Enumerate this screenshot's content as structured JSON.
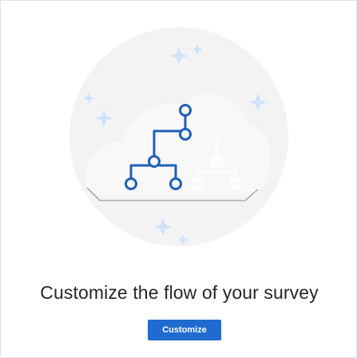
{
  "empty_state": {
    "illustration_icon": "branching-flow-icon",
    "heading": "Customize the flow of your survey",
    "button_label": "Customize"
  },
  "colors": {
    "accent": "#1f6bd0",
    "icon_blue": "#1f5fb8",
    "sparkle": "#cfe3fb",
    "background_circle": "#f3f3f3"
  }
}
